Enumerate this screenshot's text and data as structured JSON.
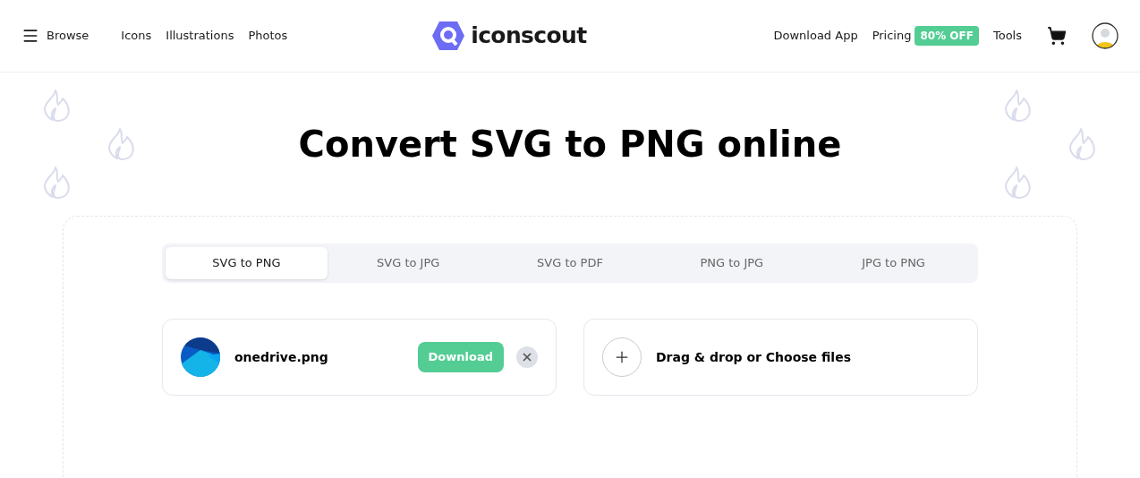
{
  "header": {
    "menu_label": "Browse",
    "nav": [
      "Icons",
      "Illustrations",
      "Photos"
    ],
    "logo_text": "iconscout",
    "links": [
      {
        "label": "Download App"
      },
      {
        "label": "Pricing",
        "badge": "80% OFF"
      },
      {
        "label": "Tools"
      }
    ]
  },
  "title": "Convert SVG to PNG online",
  "tabs": [
    {
      "label": "SVG to PNG",
      "selected": true
    },
    {
      "label": "SVG to JPG",
      "selected": false
    },
    {
      "label": "SVG to PDF",
      "selected": false
    },
    {
      "label": "PNG to JPG",
      "selected": false
    },
    {
      "label": "JPG to PNG",
      "selected": false
    }
  ],
  "file": {
    "name": "onedrive.png",
    "button": "Download"
  },
  "dropzone": {
    "label": "Drag & drop or Choose files"
  }
}
